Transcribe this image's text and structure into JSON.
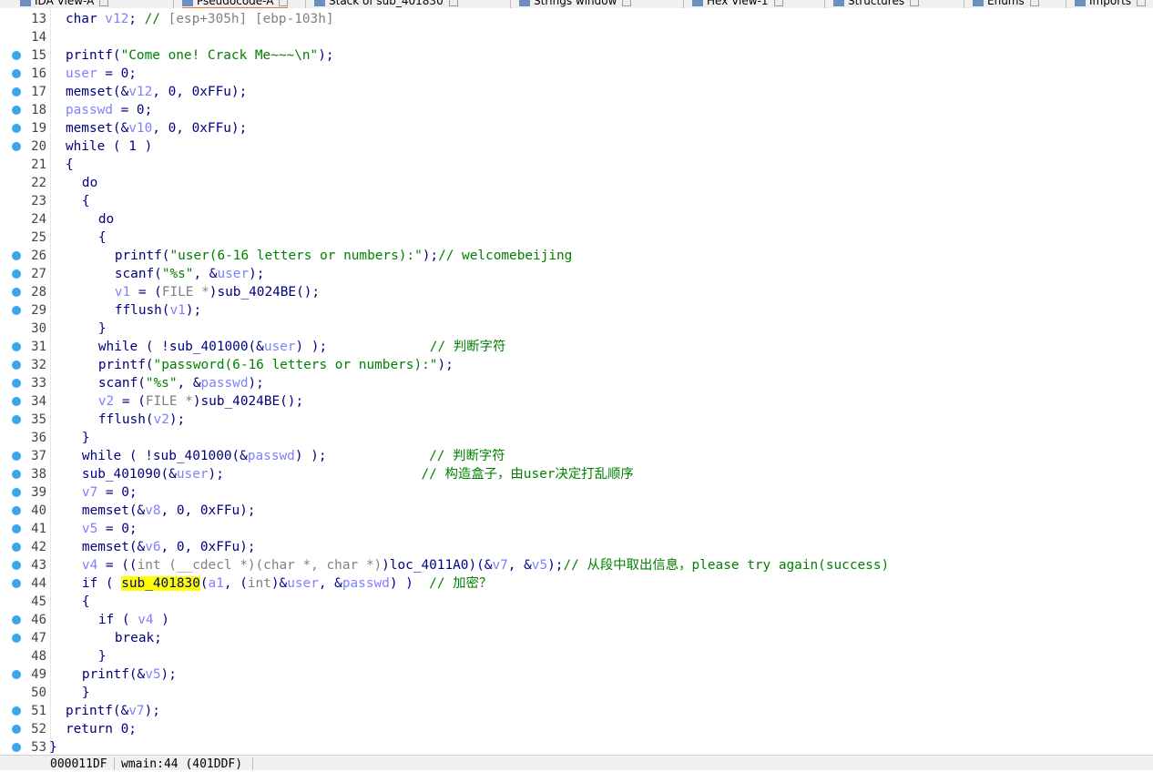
{
  "tabs": [
    {
      "label": "IDA View-A"
    },
    {
      "label": "Pseudocode-A",
      "active": true
    },
    {
      "label": "Stack of sub_401830"
    },
    {
      "label": "Strings window"
    },
    {
      "label": "Hex View-1"
    },
    {
      "label": "Structures"
    },
    {
      "label": "Enums"
    },
    {
      "label": "Imports"
    }
  ],
  "lines": [
    {
      "n": "13",
      "bp": false,
      "indent": 2,
      "parts": [
        [
          "k",
          "char "
        ],
        [
          "v",
          "v12"
        ],
        [
          "k",
          "; "
        ],
        [
          "c",
          "// "
        ],
        [
          "g",
          "[esp+305h] [ebp-103h]"
        ]
      ]
    },
    {
      "n": "14",
      "bp": false,
      "indent": 0,
      "parts": []
    },
    {
      "n": "15",
      "bp": true,
      "indent": 2,
      "parts": [
        [
          "k",
          "printf("
        ],
        [
          "s",
          "\"Come one! Crack Me~~~\\n\""
        ],
        [
          "k",
          ");"
        ]
      ]
    },
    {
      "n": "16",
      "bp": true,
      "indent": 2,
      "parts": [
        [
          "v",
          "user"
        ],
        [
          "k",
          " = 0;"
        ]
      ]
    },
    {
      "n": "17",
      "bp": true,
      "indent": 2,
      "parts": [
        [
          "k",
          "memset(&"
        ],
        [
          "v",
          "v12"
        ],
        [
          "k",
          ", 0, 0xFFu);"
        ]
      ]
    },
    {
      "n": "18",
      "bp": true,
      "indent": 2,
      "parts": [
        [
          "v",
          "passwd"
        ],
        [
          "k",
          " = 0;"
        ]
      ]
    },
    {
      "n": "19",
      "bp": true,
      "indent": 2,
      "parts": [
        [
          "k",
          "memset(&"
        ],
        [
          "v",
          "v10"
        ],
        [
          "k",
          ", 0, 0xFFu);"
        ]
      ]
    },
    {
      "n": "20",
      "bp": true,
      "indent": 2,
      "parts": [
        [
          "k",
          "while ( 1 )"
        ]
      ]
    },
    {
      "n": "21",
      "bp": false,
      "indent": 2,
      "parts": [
        [
          "k",
          "{"
        ]
      ]
    },
    {
      "n": "22",
      "bp": false,
      "indent": 4,
      "parts": [
        [
          "k",
          "do"
        ]
      ]
    },
    {
      "n": "23",
      "bp": false,
      "indent": 4,
      "parts": [
        [
          "k",
          "{"
        ]
      ]
    },
    {
      "n": "24",
      "bp": false,
      "indent": 6,
      "parts": [
        [
          "k",
          "do"
        ]
      ]
    },
    {
      "n": "25",
      "bp": false,
      "indent": 6,
      "parts": [
        [
          "k",
          "{"
        ]
      ]
    },
    {
      "n": "26",
      "bp": true,
      "indent": 8,
      "parts": [
        [
          "k",
          "printf("
        ],
        [
          "s",
          "\"user(6-16 letters or numbers):\""
        ],
        [
          "k",
          ");"
        ],
        [
          "c",
          "// welcomebeijing"
        ]
      ]
    },
    {
      "n": "27",
      "bp": true,
      "indent": 8,
      "parts": [
        [
          "k",
          "scanf("
        ],
        [
          "s",
          "\"%s\""
        ],
        [
          "k",
          ", &"
        ],
        [
          "v",
          "user"
        ],
        [
          "k",
          ");"
        ]
      ]
    },
    {
      "n": "28",
      "bp": true,
      "indent": 8,
      "parts": [
        [
          "v",
          "v1"
        ],
        [
          "k",
          " = ("
        ],
        [
          "g",
          "FILE *"
        ],
        [
          "k",
          ")sub_4024BE();"
        ]
      ]
    },
    {
      "n": "29",
      "bp": true,
      "indent": 8,
      "parts": [
        [
          "k",
          "fflush("
        ],
        [
          "v",
          "v1"
        ],
        [
          "k",
          ");"
        ]
      ]
    },
    {
      "n": "30",
      "bp": false,
      "indent": 6,
      "parts": [
        [
          "k",
          "}"
        ]
      ]
    },
    {
      "n": "31",
      "bp": true,
      "indent": 6,
      "parts": [
        [
          "k",
          "while ( !sub_401000(&"
        ],
        [
          "v",
          "user"
        ],
        [
          "k",
          ") );             "
        ],
        [
          "c",
          "// 判断字符"
        ]
      ]
    },
    {
      "n": "32",
      "bp": true,
      "indent": 6,
      "parts": [
        [
          "k",
          "printf("
        ],
        [
          "s",
          "\"password(6-16 letters or numbers):\""
        ],
        [
          "k",
          ");"
        ]
      ]
    },
    {
      "n": "33",
      "bp": true,
      "indent": 6,
      "parts": [
        [
          "k",
          "scanf("
        ],
        [
          "s",
          "\"%s\""
        ],
        [
          "k",
          ", &"
        ],
        [
          "v",
          "passwd"
        ],
        [
          "k",
          ");"
        ]
      ]
    },
    {
      "n": "34",
      "bp": true,
      "indent": 6,
      "parts": [
        [
          "v",
          "v2"
        ],
        [
          "k",
          " = ("
        ],
        [
          "g",
          "FILE *"
        ],
        [
          "k",
          ")sub_4024BE();"
        ]
      ]
    },
    {
      "n": "35",
      "bp": true,
      "indent": 6,
      "parts": [
        [
          "k",
          "fflush("
        ],
        [
          "v",
          "v2"
        ],
        [
          "k",
          ");"
        ]
      ]
    },
    {
      "n": "36",
      "bp": false,
      "indent": 4,
      "parts": [
        [
          "k",
          "}"
        ]
      ]
    },
    {
      "n": "37",
      "bp": true,
      "indent": 4,
      "parts": [
        [
          "k",
          "while ( !sub_401000(&"
        ],
        [
          "v",
          "passwd"
        ],
        [
          "k",
          ") );             "
        ],
        [
          "c",
          "// 判断字符"
        ]
      ]
    },
    {
      "n": "38",
      "bp": true,
      "indent": 4,
      "parts": [
        [
          "k",
          "sub_401090(&"
        ],
        [
          "v",
          "user"
        ],
        [
          "k",
          ");                         "
        ],
        [
          "c",
          "// 构造盒子，由user决定打乱顺序"
        ]
      ]
    },
    {
      "n": "39",
      "bp": true,
      "indent": 4,
      "parts": [
        [
          "v",
          "v7"
        ],
        [
          "k",
          " = 0;"
        ]
      ]
    },
    {
      "n": "40",
      "bp": true,
      "indent": 4,
      "parts": [
        [
          "k",
          "memset(&"
        ],
        [
          "v",
          "v8"
        ],
        [
          "k",
          ", 0, 0xFFu);"
        ]
      ]
    },
    {
      "n": "41",
      "bp": true,
      "indent": 4,
      "parts": [
        [
          "v",
          "v5"
        ],
        [
          "k",
          " = 0;"
        ]
      ]
    },
    {
      "n": "42",
      "bp": true,
      "indent": 4,
      "parts": [
        [
          "k",
          "memset(&"
        ],
        [
          "v",
          "v6"
        ],
        [
          "k",
          ", 0, 0xFFu);"
        ]
      ]
    },
    {
      "n": "43",
      "bp": true,
      "indent": 4,
      "parts": [
        [
          "v",
          "v4"
        ],
        [
          "k",
          " = (("
        ],
        [
          "g",
          "int (__cdecl *)(char *, char *)"
        ],
        [
          "k",
          ")loc_4011A0)(&"
        ],
        [
          "v",
          "v7"
        ],
        [
          "k",
          ", &"
        ],
        [
          "v",
          "v5"
        ],
        [
          "k",
          ");"
        ],
        [
          "c",
          "// 从段中取出信息，please try again(success)"
        ]
      ]
    },
    {
      "n": "44",
      "bp": true,
      "indent": 4,
      "parts": [
        [
          "k",
          "if ( "
        ],
        [
          "hl",
          "sub_401830"
        ],
        [
          "k",
          "("
        ],
        [
          "v",
          "a1"
        ],
        [
          "k",
          ", ("
        ],
        [
          "g",
          "int"
        ],
        [
          "k",
          ")&"
        ],
        [
          "v",
          "user"
        ],
        [
          "k",
          ", &"
        ],
        [
          "v",
          "passwd"
        ],
        [
          "k",
          ") )  "
        ],
        [
          "c",
          "// 加密？"
        ]
      ]
    },
    {
      "n": "45",
      "bp": false,
      "indent": 4,
      "parts": [
        [
          "k",
          "{"
        ]
      ]
    },
    {
      "n": "46",
      "bp": true,
      "indent": 6,
      "parts": [
        [
          "k",
          "if ( "
        ],
        [
          "v",
          "v4"
        ],
        [
          "k",
          " )"
        ]
      ]
    },
    {
      "n": "47",
      "bp": true,
      "indent": 8,
      "parts": [
        [
          "k",
          "break;"
        ]
      ]
    },
    {
      "n": "48",
      "bp": false,
      "indent": 6,
      "parts": [
        [
          "k",
          "}"
        ]
      ]
    },
    {
      "n": "49",
      "bp": true,
      "indent": 4,
      "parts": [
        [
          "k",
          "printf(&"
        ],
        [
          "v",
          "v5"
        ],
        [
          "k",
          ");"
        ]
      ]
    },
    {
      "n": "50",
      "bp": false,
      "indent": 4,
      "parts": [
        [
          "k",
          "}"
        ]
      ]
    },
    {
      "n": "51",
      "bp": true,
      "indent": 2,
      "parts": [
        [
          "k",
          "printf(&"
        ],
        [
          "v",
          "v7"
        ],
        [
          "k",
          ");"
        ]
      ]
    },
    {
      "n": "52",
      "bp": true,
      "indent": 2,
      "parts": [
        [
          "k",
          "return 0;"
        ]
      ]
    },
    {
      "n": "53",
      "bp": true,
      "indent": 0,
      "parts": [
        [
          "k",
          "}"
        ]
      ]
    }
  ],
  "status": {
    "address": "000011DF",
    "location": "wmain:44 (401DDF)"
  }
}
